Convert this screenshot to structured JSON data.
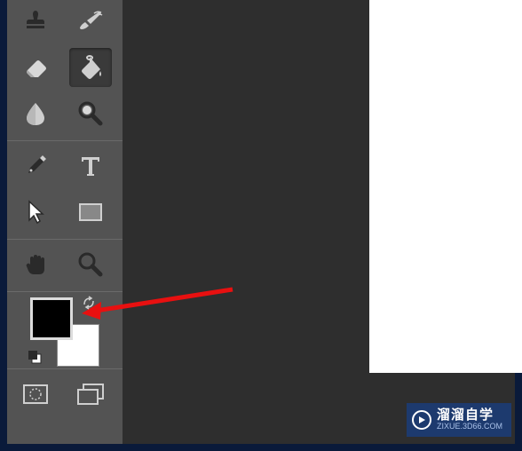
{
  "tools": {
    "stamp": "stamp-tool",
    "history_brush": "history-brush-tool",
    "eraser": "eraser-tool",
    "paint_bucket": "paint-bucket-tool",
    "blur": "blur-tool",
    "dodge": "dodge-tool",
    "pen": "pen-tool",
    "type": "type-tool",
    "path_select": "path-selection-tool",
    "rectangle": "rectangle-tool",
    "hand": "hand-tool",
    "zoom": "zoom-tool"
  },
  "colors": {
    "foreground": "#000000",
    "background": "#ffffff"
  },
  "bottom_tools": {
    "quickmask": "quick-mask-mode",
    "screenmode": "screen-mode"
  },
  "watermark": {
    "main": "溜溜自学",
    "sub": "ZIXUE.3D66.COM"
  }
}
